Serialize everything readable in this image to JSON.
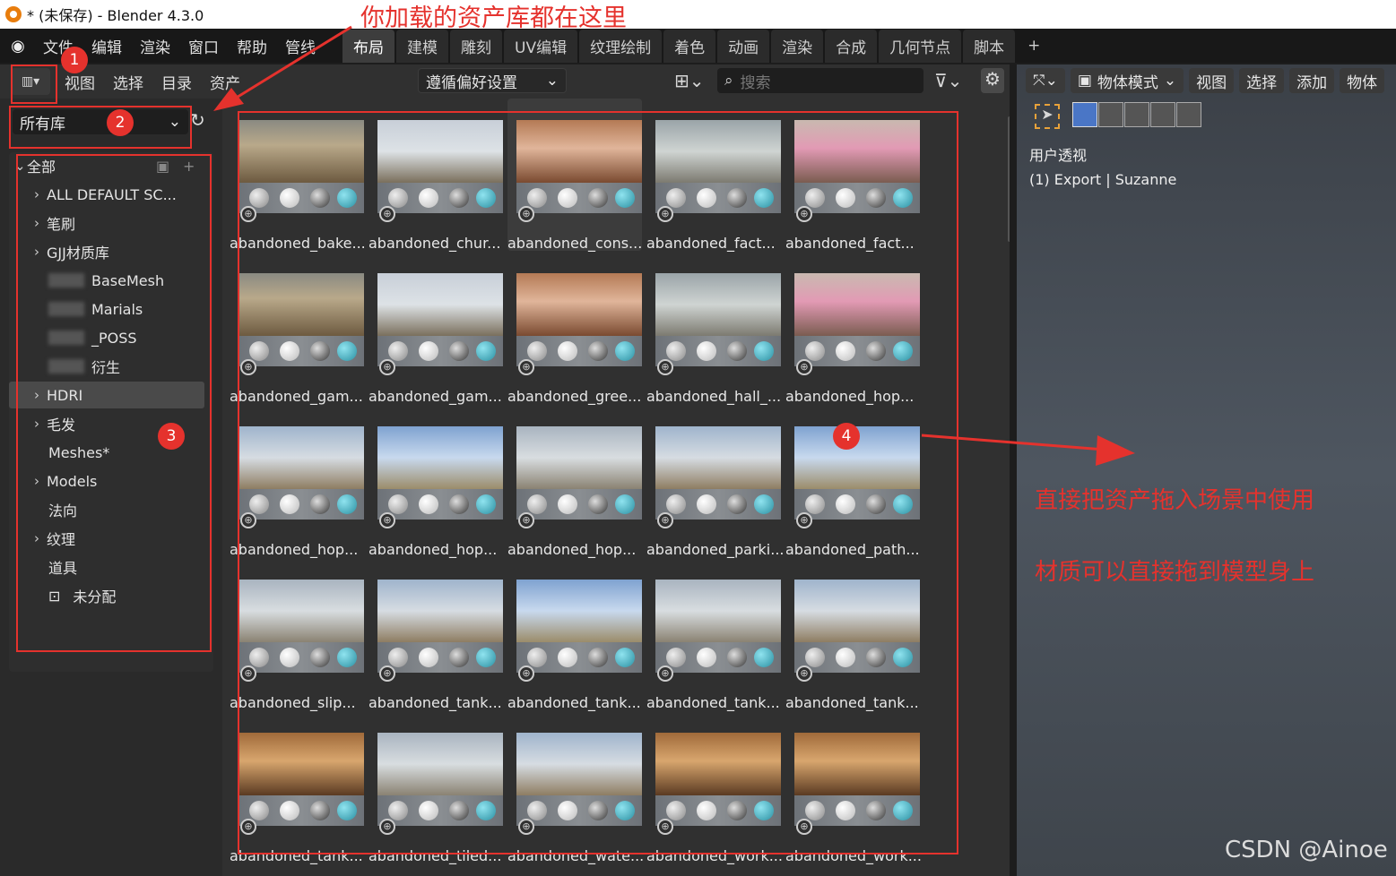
{
  "window": {
    "title": "* (未保存) - Blender 4.3.0"
  },
  "menu": {
    "items": [
      "文件",
      "编辑",
      "渲染",
      "窗口",
      "帮助",
      "管线"
    ]
  },
  "workspaces": {
    "tabs": [
      "布局",
      "建模",
      "雕刻",
      "UV编辑",
      "纹理绘制",
      "着色",
      "动画",
      "渲染",
      "合成",
      "几何节点",
      "脚本"
    ],
    "active": "布局",
    "plus": "+"
  },
  "asset_header": {
    "menus": [
      "视图",
      "选择",
      "目录",
      "资产"
    ],
    "import_method": "遵循偏好设置",
    "search_placeholder": "搜索"
  },
  "library": {
    "selected": "所有库"
  },
  "tree": {
    "root": "全部",
    "items": [
      {
        "label": "ALL DEFAULT SC...",
        "chevron": true,
        "blurred": false
      },
      {
        "label": "笔刷",
        "chevron": true,
        "blurred": false
      },
      {
        "label": "GJJ材质库",
        "chevron": true,
        "blurred": false
      },
      {
        "label": "BaseMesh",
        "chevron": false,
        "blurred": true
      },
      {
        "label": "Marials",
        "chevron": false,
        "blurred": true
      },
      {
        "label": "_POSS",
        "chevron": false,
        "blurred": true
      },
      {
        "label": "衍生",
        "chevron": false,
        "blurred": true
      },
      {
        "label": "HDRI",
        "chevron": true,
        "blurred": false,
        "selected": true
      },
      {
        "label": "毛发",
        "chevron": true,
        "blurred": false
      },
      {
        "label": "Meshes*",
        "chevron": false,
        "blurred": false
      },
      {
        "label": "Models",
        "chevron": true,
        "blurred": false
      },
      {
        "label": "法向",
        "chevron": false,
        "blurred": false
      },
      {
        "label": "纹理",
        "chevron": true,
        "blurred": false
      },
      {
        "label": "道具",
        "chevron": false,
        "blurred": false
      },
      {
        "label": "未分配",
        "chevron": false,
        "blurred": false
      }
    ]
  },
  "assets": [
    "abandoned_bake...",
    "abandoned_chur...",
    "abandoned_cons...",
    "abandoned_fact...",
    "abandoned_fact...",
    "abandoned_gam...",
    "abandoned_gam...",
    "abandoned_gree...",
    "abandoned_hall_...",
    "abandoned_hop...",
    "abandoned_hop...",
    "abandoned_hop...",
    "abandoned_hop...",
    "abandoned_parki...",
    "abandoned_path...",
    "abandoned_slip...",
    "abandoned_tank...",
    "abandoned_tank...",
    "abandoned_tank...",
    "abandoned_tank...",
    "abandoned_tank...",
    "abandoned_tiled...",
    "abandoned_wate...",
    "abandoned_work...",
    "abandoned_work..."
  ],
  "viewport": {
    "mode": "物体模式",
    "menus": [
      "视图",
      "选择",
      "添加",
      "物体"
    ],
    "view_name": "用户透视",
    "object_info": "(1) Export | Suzanne"
  },
  "annotations": {
    "top_note": "你加载的资产库都在这里",
    "note1": "直接把资产拖入场景中使用",
    "note2": "材质可以直接拖到模型身上",
    "badges": [
      "1",
      "2",
      "3",
      "4"
    ]
  },
  "watermark": "CSDN @Ainoe",
  "colors": {
    "annotation_red": "#e5322d",
    "blender_orange": "#e87d0d",
    "sphere_teal": "#3bb3c4"
  }
}
